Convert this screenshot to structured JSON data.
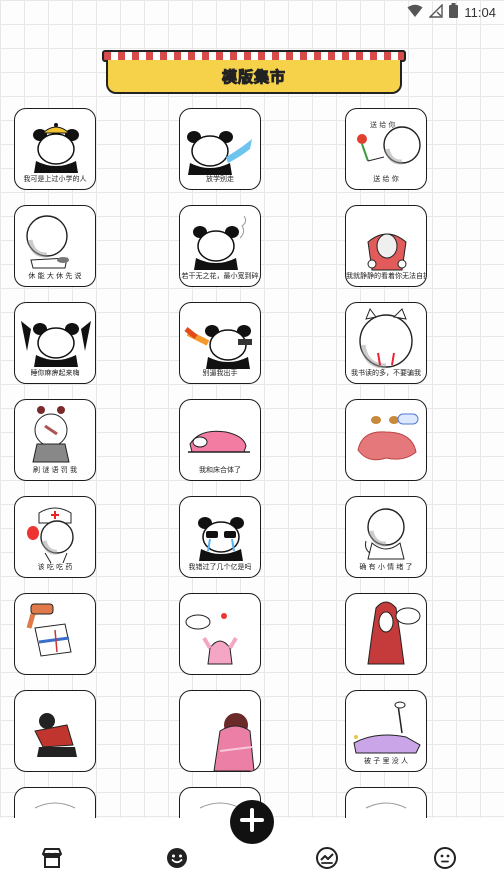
{
  "status_bar": {
    "time": "11:04"
  },
  "banner": {
    "title": "模版集市"
  },
  "templates": [
    {
      "caption": "我可是上过小学的人",
      "icon": "panda-cap-icon"
    },
    {
      "caption": "放学别走",
      "icon": "panda-water-icon"
    },
    {
      "caption": "送 给 你",
      "icon": "flower-gift-icon"
    },
    {
      "caption": "休 能 大 休 先 说",
      "icon": "big-head-icon"
    },
    {
      "caption": "若干无之花，最小宽到碎",
      "icon": "panda-smoke-icon"
    },
    {
      "caption": "我就静静的看着你无法自拔",
      "icon": "meat-hands-icon"
    },
    {
      "caption": "睡你麻痹起来嗨",
      "icon": "panda-hands-up-icon"
    },
    {
      "caption": "别逼我出手",
      "icon": "panda-gun-icon"
    },
    {
      "caption": "我书读的多，不要骗我",
      "icon": "crying-cat-icon"
    },
    {
      "caption": "刷 谜 语 罚 我",
      "icon": "gray-kid-icon"
    },
    {
      "caption": "我和床合体了",
      "icon": "pink-bed-icon"
    },
    {
      "caption": "",
      "icon": "meat-blob-icon"
    },
    {
      "caption": "该 吃 吃 药",
      "icon": "nurse-icon"
    },
    {
      "caption": "我错过了几个亿是吗",
      "icon": "panda-sunglasses-icon"
    },
    {
      "caption": "确 有 小 情 绪 了",
      "icon": "sulky-head-icon"
    },
    {
      "caption": "",
      "icon": "headless-man-icon"
    },
    {
      "caption": "",
      "icon": "pink-arms-icon"
    },
    {
      "caption": "",
      "icon": "red-hood-icon"
    },
    {
      "caption": "",
      "icon": "red-kid-icon"
    },
    {
      "caption": "",
      "icon": "pink-dress-icon"
    },
    {
      "caption": "被 子 里 没 人",
      "icon": "blanket-icon"
    },
    {
      "caption": "",
      "icon": "partial-card-icon"
    },
    {
      "caption": "",
      "icon": "partial-card-icon"
    },
    {
      "caption": "",
      "icon": "partial-card-icon"
    }
  ],
  "bottom_nav": {
    "items": [
      {
        "icon": "store-icon"
      },
      {
        "icon": "smile-filled-icon"
      },
      {
        "icon": "chart-icon"
      },
      {
        "icon": "face-outline-icon"
      }
    ],
    "fab_icon": "plus-icon"
  }
}
